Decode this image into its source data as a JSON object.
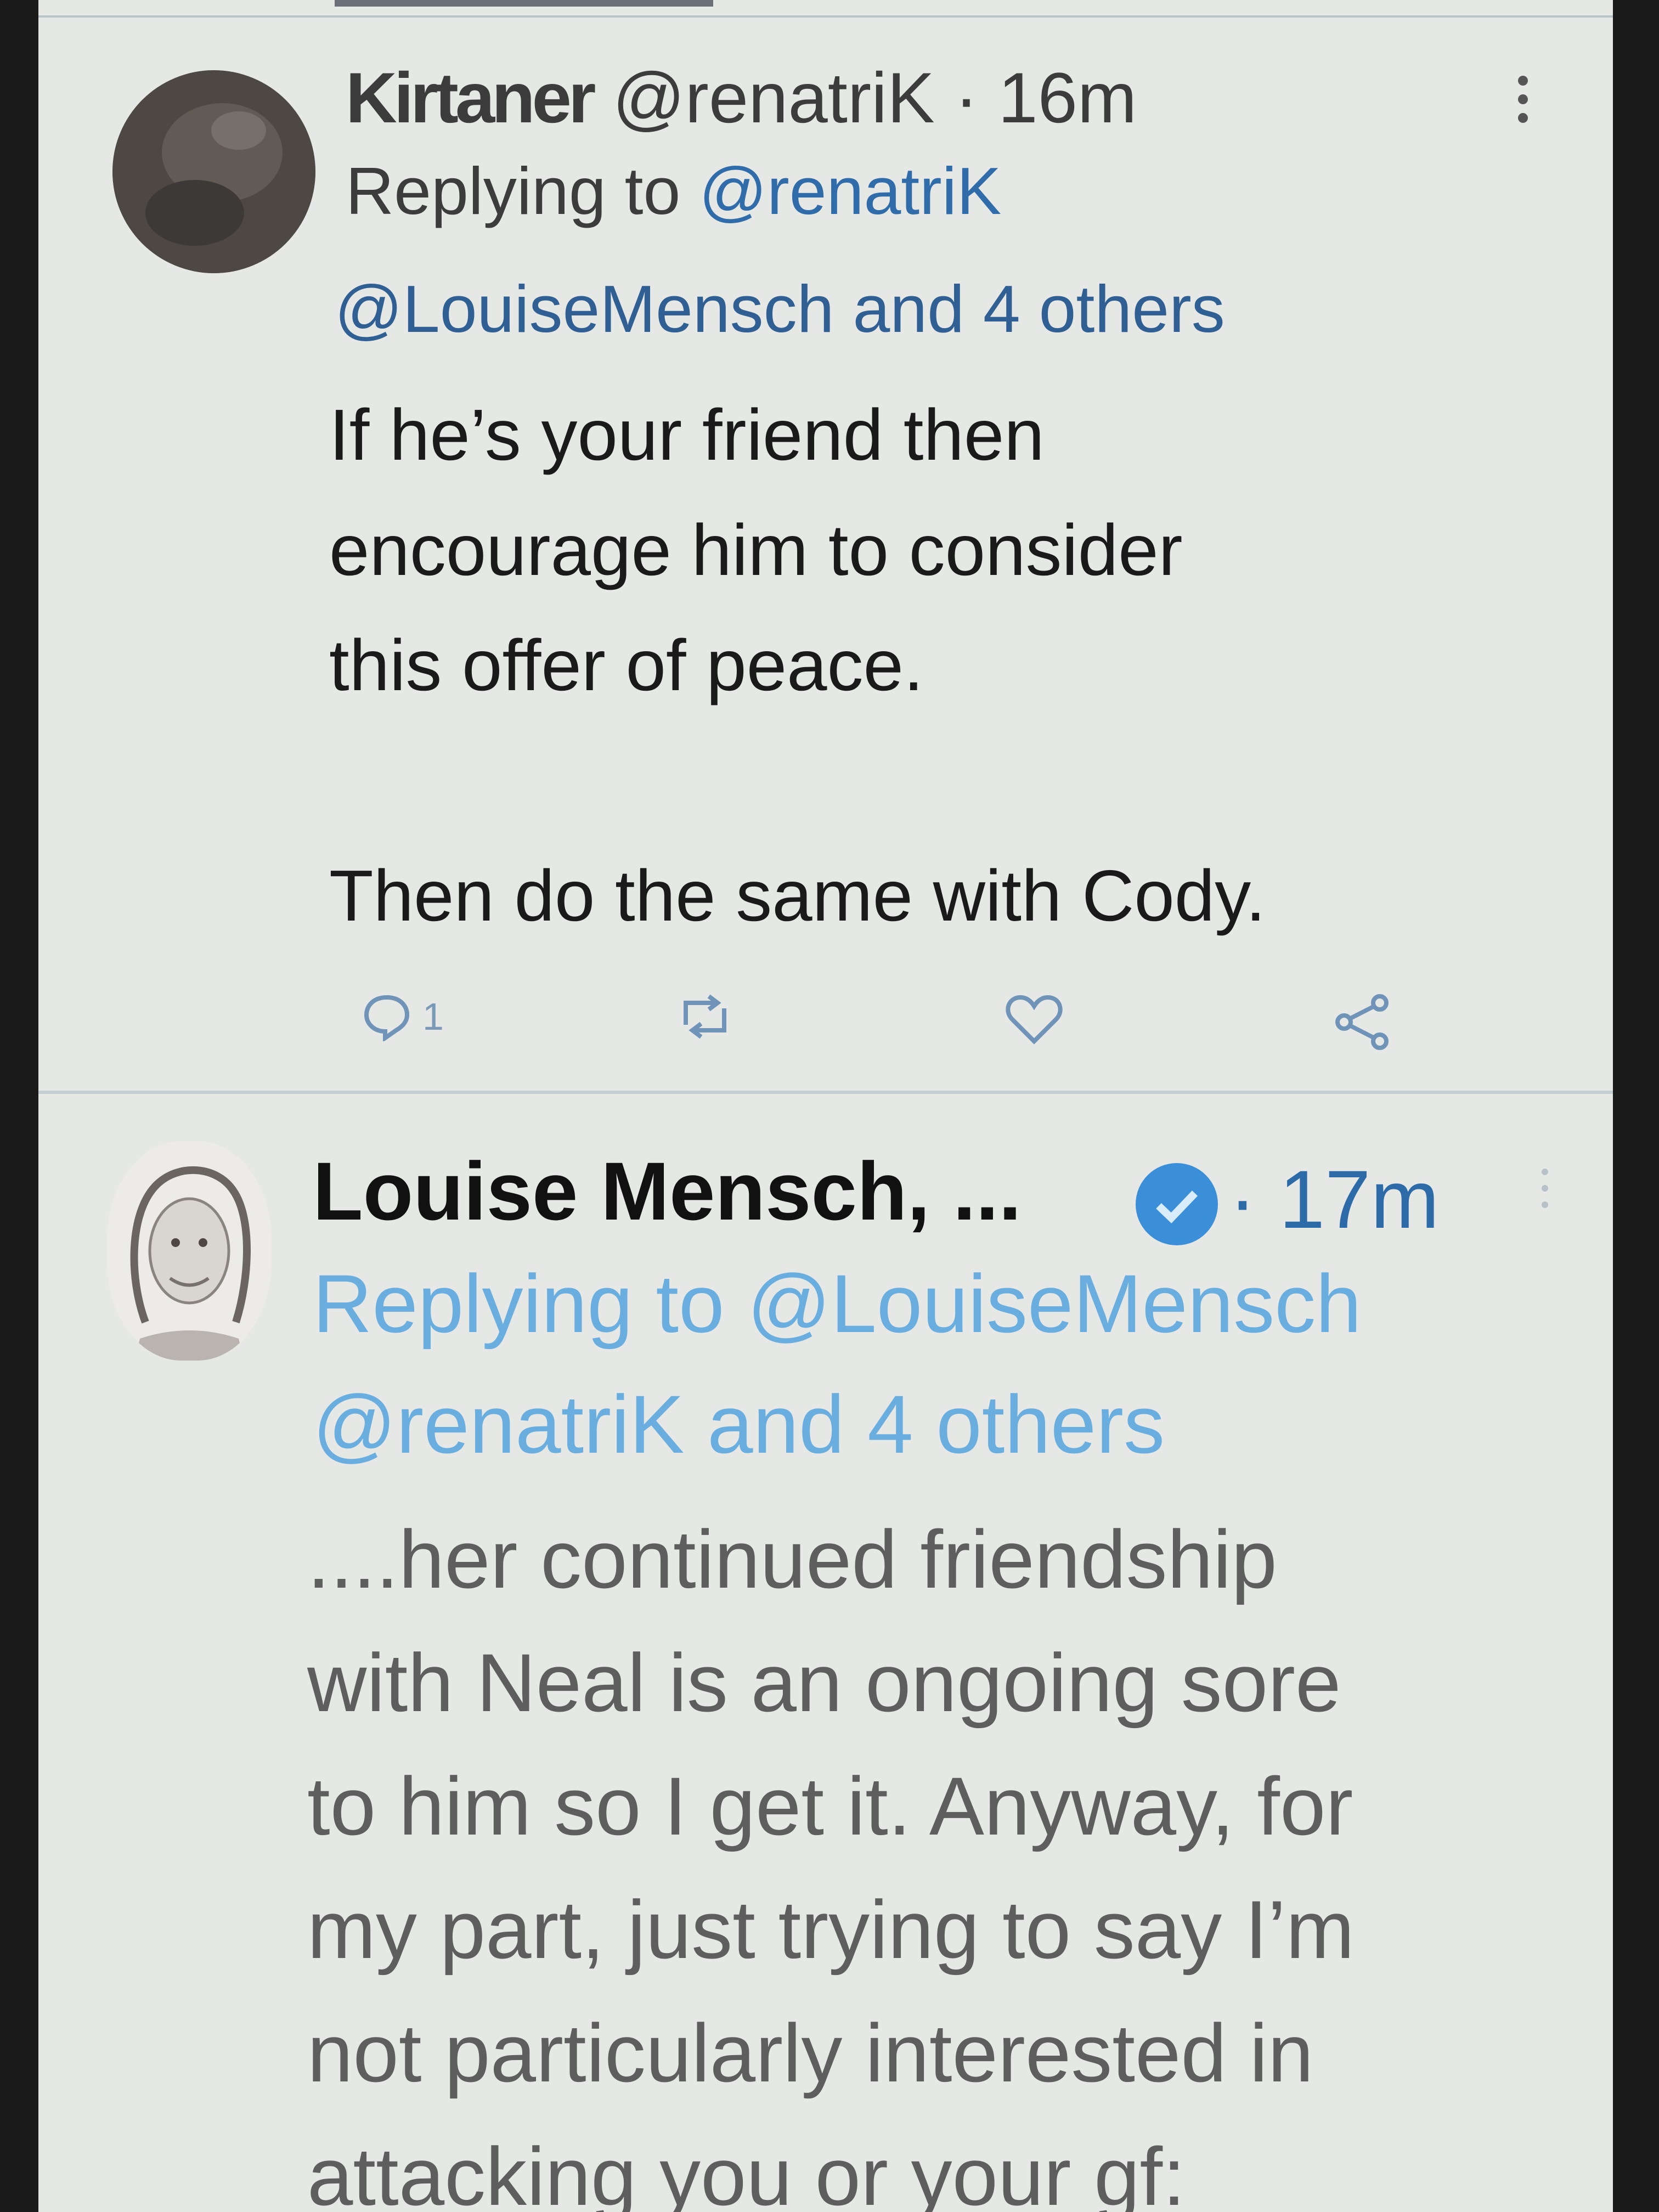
{
  "tweet1": {
    "author_name": "Kirtaner",
    "author_handle": "@renatriK",
    "separator": "·",
    "time": "16m",
    "replying_prefix": "Replying to ",
    "replying_to": "@renatriK",
    "replying_line2_mention": "@LouiseMensch",
    "replying_line2_rest": " and 4 others",
    "body": "If he’s your friend then\nencourage him to consider\nthis offer of peace.\n\nThen do the same with Cody.",
    "reply_count": "1",
    "icons": [
      "reply-icon",
      "retweet-icon",
      "like-icon",
      "share-icon",
      "more-icon"
    ]
  },
  "tweet2": {
    "author_name": "Louise Mensch, ...",
    "verified": true,
    "separator": "·",
    "time": "17m",
    "replying_prefix": "Replying to ",
    "replying_to": "@LouiseMensch",
    "replying_line2_mention": "@renatriK",
    "replying_line2_rest": " and 4 others",
    "body": "....her continued friendship\nwith Neal is an ongoing sore\nto him so I get it. Anyway, for\nmy part, just trying to say I’m\nnot particularly interested in\nattacking you or your gf:",
    "icons": [
      "verified-icon",
      "more-icon"
    ]
  },
  "colors": {
    "background": "#e6e8e6",
    "link": "#2f6ca9",
    "link_faded": "#6aaee0",
    "verified": "#3b8fd8"
  }
}
